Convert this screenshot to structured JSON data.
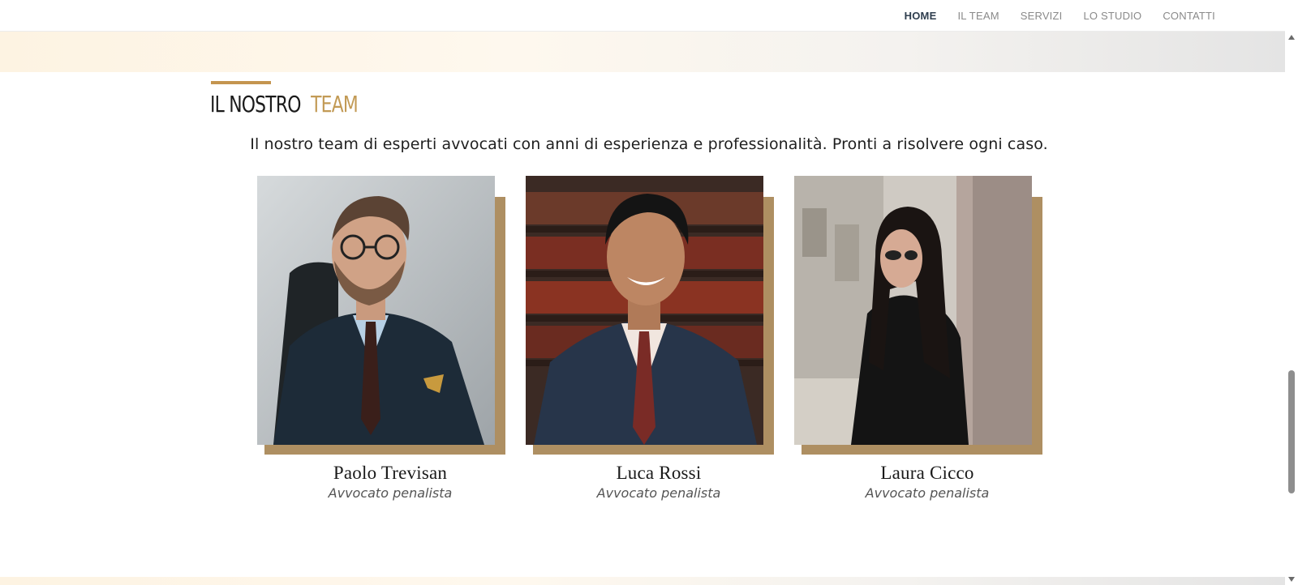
{
  "nav": {
    "items": [
      {
        "label": "HOME",
        "active": true
      },
      {
        "label": "IL TEAM",
        "active": false
      },
      {
        "label": "SERVIZI",
        "active": false
      },
      {
        "label": "LO STUDIO",
        "active": false
      },
      {
        "label": "CONTATTI",
        "active": false
      }
    ]
  },
  "section": {
    "title_part1": "IL NOSTRO",
    "title_part2": "TEAM",
    "subtitle": "Il nostro team di esperti avvocati con anni di esperienza e professionalità. Pronti a risolvere ogni caso."
  },
  "team": [
    {
      "name": "Paolo Trevisan",
      "role": "Avvocato penalista",
      "photo": "man-with-glasses-portrait"
    },
    {
      "name": "Luca Rossi",
      "role": "Avvocato penalista",
      "photo": "smiling-man-library-portrait"
    },
    {
      "name": "Laura Cicco",
      "role": "Avvocato penalista",
      "photo": "woman-sunglasses-street-portrait"
    }
  ],
  "colors": {
    "accent_gold": "#c29a55",
    "card_shadow": "#ae8f62",
    "nav_active": "#2f3e4e",
    "nav_inactive": "#8a8a8a"
  }
}
